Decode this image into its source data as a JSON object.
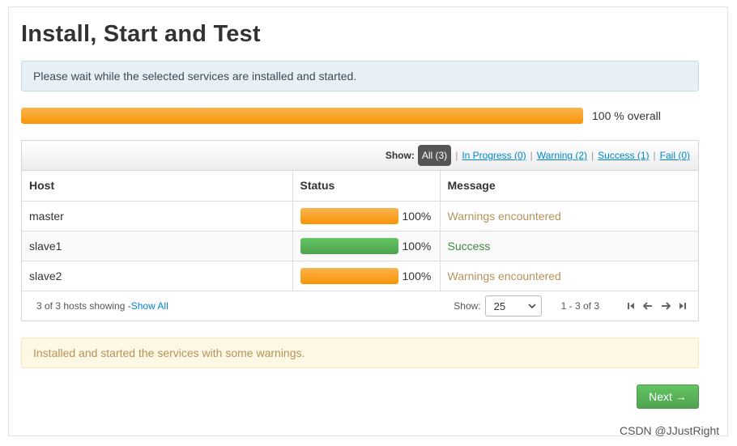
{
  "page": {
    "title": "Install, Start and Test",
    "info_message": "Please wait while the selected services are installed and started.",
    "overall_progress": 100,
    "overall_label": "100 % overall"
  },
  "filters": {
    "show_label": "Show:",
    "all": "All (3)",
    "in_progress": "In Progress (0)",
    "warning": "Warning (2)",
    "success": "Success (1)",
    "fail": "Fail (0)"
  },
  "table": {
    "headers": [
      "Host",
      "Status",
      "Message"
    ],
    "rows": [
      {
        "host": "master",
        "progress": 100,
        "percent": "100%",
        "status_color": "#f89406",
        "message": "Warnings encountered",
        "message_type": "warning"
      },
      {
        "host": "slave1",
        "progress": 100,
        "percent": "100%",
        "status_color": "#51a351",
        "message": "Success",
        "message_type": "success"
      },
      {
        "host": "slave2",
        "progress": 100,
        "percent": "100%",
        "status_color": "#f89406",
        "message": "Warnings encountered",
        "message_type": "warning"
      }
    ],
    "footer": {
      "showing_text": "3 of 3 hosts showing - ",
      "show_all": "Show All",
      "show_label": "Show:",
      "page_size": "25",
      "range": "1 - 3 of 3"
    }
  },
  "result_message": "Installed and started the services with some warnings.",
  "next_button": "Next →",
  "watermark": "CSDN @JJustRight",
  "colors": {
    "progress_orange": "#f89406",
    "progress_green": "#51a351",
    "link": "#0088cc",
    "warning_text": "#b5925a"
  },
  "icons": {
    "first_page": "first-page-icon",
    "prev_page": "prev-page-icon",
    "next_page": "next-page-icon",
    "last_page": "last-page-icon",
    "select_dropdown": "chevron-down-icon"
  }
}
